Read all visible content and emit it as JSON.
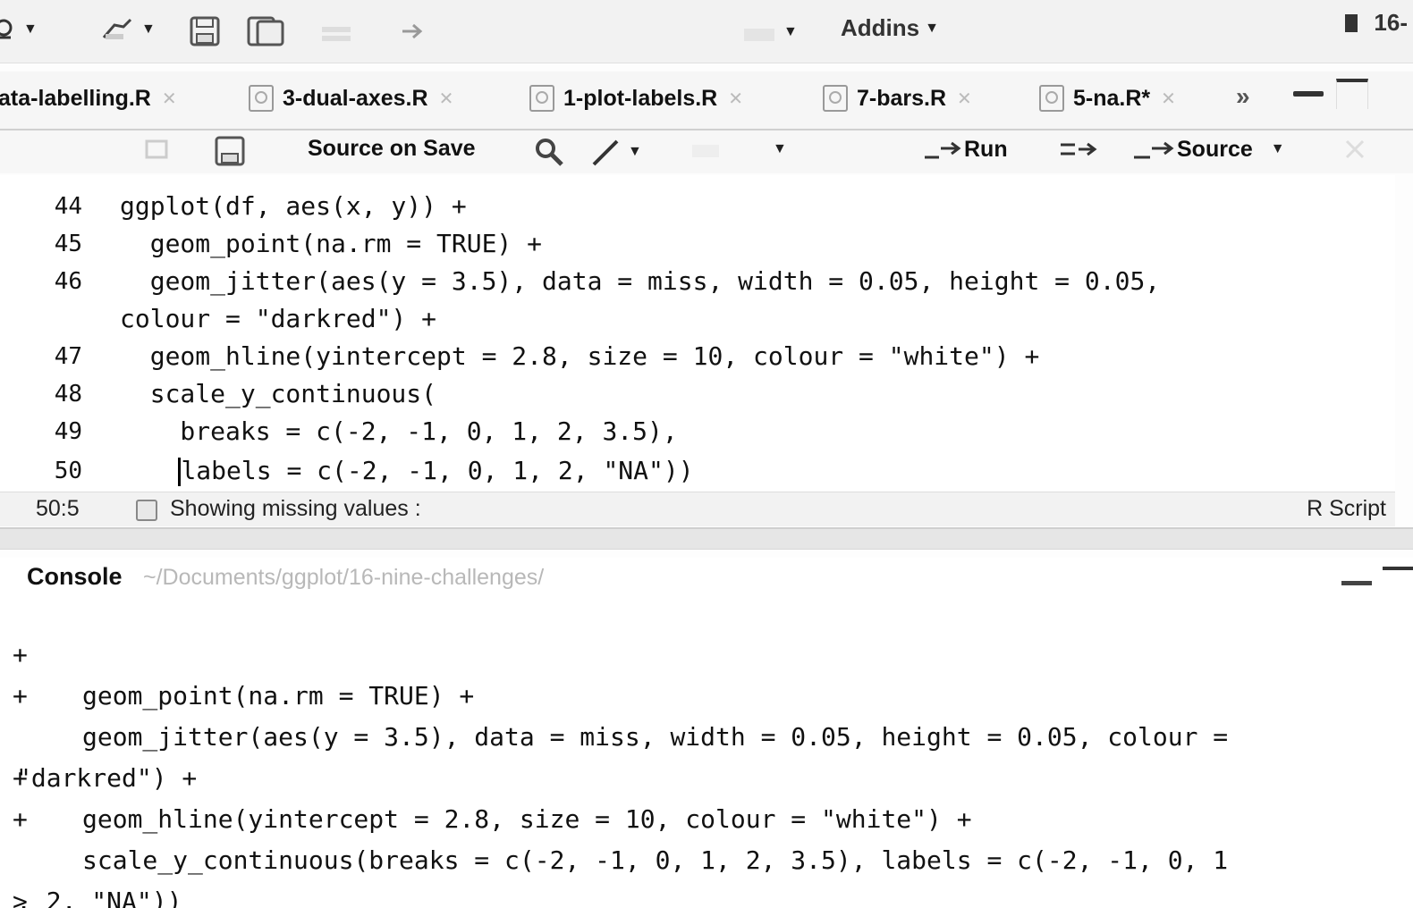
{
  "toolbar": {
    "addins_label": "Addins",
    "project_label": "16-"
  },
  "tabs": [
    {
      "label": "ata-labelling.R"
    },
    {
      "label": "3-dual-axes.R"
    },
    {
      "label": "1-plot-labels.R"
    },
    {
      "label": "7-bars.R"
    },
    {
      "label": "5-na.R*"
    }
  ],
  "tab_overflow": "»",
  "editor_toolbar": {
    "source_on_save": "Source on Save",
    "run_label": "Run",
    "source_label": "Source"
  },
  "editor": {
    "lines": [
      {
        "num": "44",
        "text": "ggplot(df, aes(x, y)) +"
      },
      {
        "num": "45",
        "text": "  geom_point(na.rm = TRUE) +"
      },
      {
        "num": "46",
        "text": "  geom_jitter(aes(y = 3.5), data = miss, width = 0.05, height = 0.05,"
      },
      {
        "num": "",
        "text": "colour = \"darkred\") +"
      },
      {
        "num": "47",
        "text": "  geom_hline(yintercept = 2.8, size = 10, colour = \"white\") +"
      },
      {
        "num": "48",
        "text": "  scale_y_continuous("
      },
      {
        "num": "49",
        "text": "    breaks = c(-2, -1, 0, 1, 2, 3.5),"
      },
      {
        "num": "50",
        "text_pre": "    ",
        "text_post": "labels = c(-2, -1, 0, 1, 2, \"NA\"))"
      }
    ]
  },
  "status": {
    "cursor_pos": "50:5",
    "section": "Showing missing values :",
    "file_type": "R Script"
  },
  "console": {
    "title": "Console",
    "path": "~/Documents/ggplot/16-nine-challenges/",
    "lines": [
      {
        "prompt": "+",
        "text": "geom_point(na.rm = TRUE) +"
      },
      {
        "prompt": "+",
        "text": "geom_jitter(aes(y = 3.5), data = miss, width = 0.05, height = 0.05, colour ="
      },
      {
        "prompt": "",
        "text": "\"darkred\") +"
      },
      {
        "prompt": "+",
        "text": "geom_hline(yintercept = 2.8, size = 10, colour = \"white\") +"
      },
      {
        "prompt": "+",
        "text": "scale_y_continuous(breaks = c(-2, -1, 0, 1, 2, 3.5), labels = c(-2, -1, 0, 1"
      },
      {
        "prompt": "",
        "text": ", 2, \"NA\"))"
      },
      {
        "prompt": ">",
        "text": ""
      }
    ]
  }
}
